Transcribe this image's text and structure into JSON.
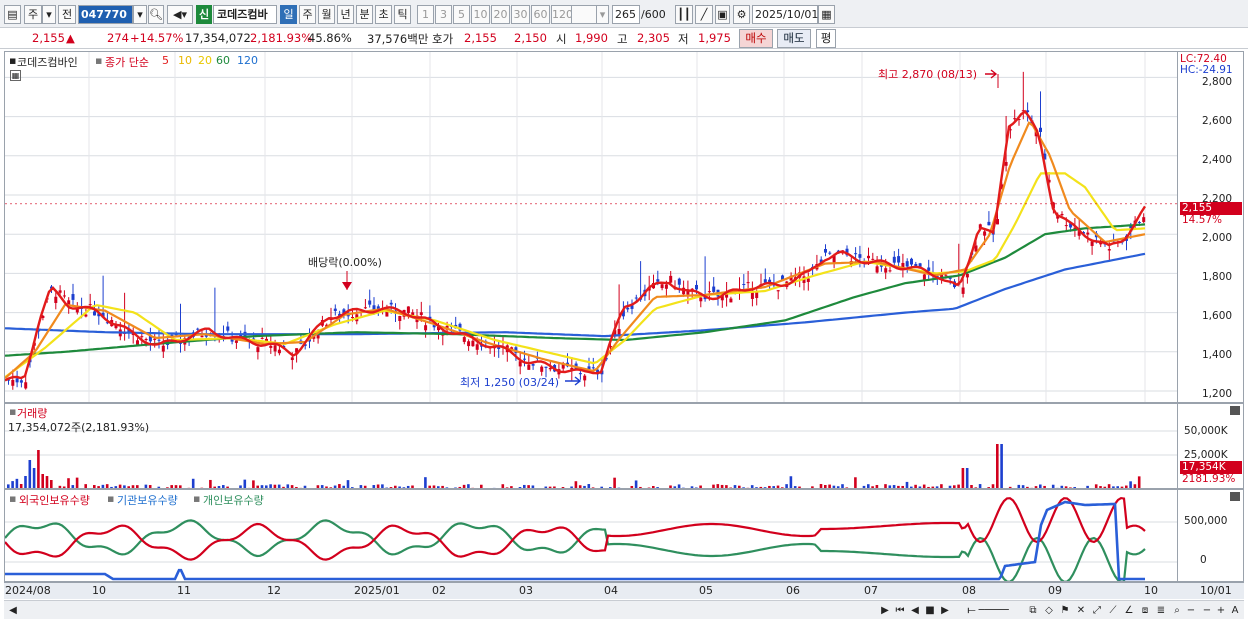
{
  "toolbar": {
    "market": "주",
    "prev_label": "전",
    "code": "047770",
    "sin": "신",
    "name": "코데즈컴바",
    "periods": [
      "일",
      "주",
      "월",
      "년",
      "분",
      "초",
      "틱"
    ],
    "active_period": "일",
    "intervals": [
      "1",
      "3",
      "5",
      "10",
      "20",
      "30",
      "60",
      "120"
    ],
    "count": "265",
    "count_total": "/600",
    "date": "2025/10/01"
  },
  "info": {
    "price": "2,155",
    "change_arrow": "▲",
    "change": "274",
    "change_pct": "+14.57%",
    "volume": "17,354,072",
    "volume_ratio": "2,181.93%",
    "turnover": "45.86%",
    "amount": "37,576백만",
    "quote_label": "호가",
    "ask": "2,155",
    "bid": "2,150",
    "open_label": "시",
    "open": "1,990",
    "high_label": "고",
    "high": "2,305",
    "low_label": "저",
    "low": "1,975",
    "buy": "매수",
    "sell": "매도",
    "avg": "평"
  },
  "price_panel": {
    "legend_name": "코데즈컴바인",
    "legend_ma": "종가 단순",
    "ma": [
      {
        "period": "5",
        "color": "#e21b1b"
      },
      {
        "period": "10",
        "color": "#f5c400"
      },
      {
        "period": "20",
        "color": "#f5d000"
      },
      {
        "period": "60",
        "color": "#1e8a3c"
      },
      {
        "period": "120",
        "color": "#2a5fd8"
      }
    ],
    "high_note": "최고 2,870 (08/13)",
    "low_note": "최저 1,250 (03/24)",
    "dividend_note": "배당락(0.00%)",
    "lc": "LC:72.40",
    "hc": "HC:-24.91",
    "yticks": [
      "2,800",
      "2,600",
      "2,400",
      "2,200",
      "2,000",
      "1,800",
      "1,600",
      "1,400",
      "1,200"
    ],
    "current_tag": "2,155",
    "current_pct": "14.57%"
  },
  "volume_panel": {
    "title": "거래량",
    "value": "17,354,072주(2,181.93%)",
    "yticks": [
      "50,000K",
      "25,000K"
    ],
    "current_tag": "17,354K",
    "current_pct": "2181.93%"
  },
  "holder_panel": {
    "legend": [
      "외국인보유수량",
      "기관보유수량",
      "개인보유수량"
    ],
    "legend_colors": [
      "#d2001d",
      "#1e6fcf",
      "#2f8f5e"
    ],
    "yticks": [
      "500,000",
      "0"
    ]
  },
  "dates": [
    "2024/08",
    "10",
    "11",
    "12",
    "2025/01",
    "02",
    "03",
    "04",
    "05",
    "06",
    "07",
    "08",
    "09",
    "10",
    "10/01"
  ]
}
